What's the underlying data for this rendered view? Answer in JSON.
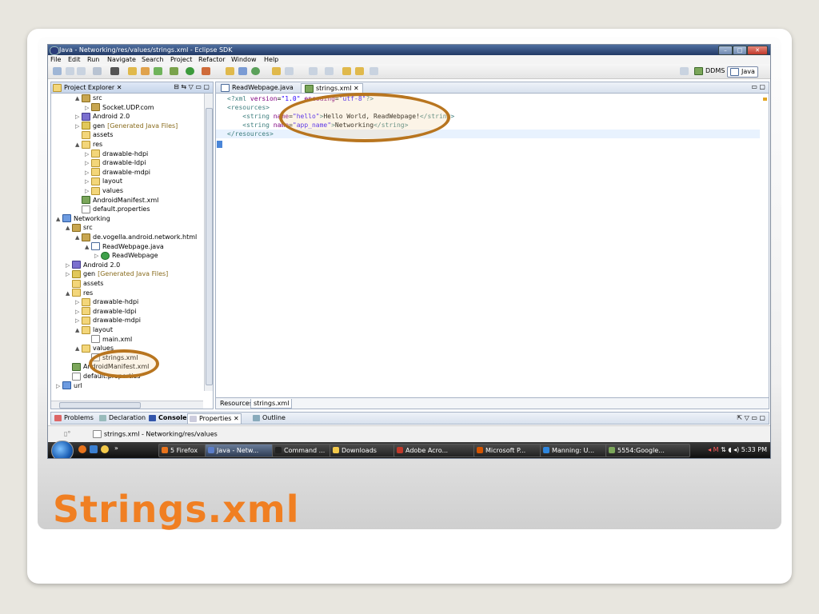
{
  "slide": {
    "title": "Strings.xml"
  },
  "window": {
    "title": "Java - Networking/res/values/strings.xml - Eclipse SDK",
    "buttons": [
      "–",
      "□",
      "✕"
    ]
  },
  "menu": [
    "File",
    "Edit",
    "Run",
    "Navigate",
    "Search",
    "Project",
    "Refactor",
    "Window",
    "Help"
  ],
  "perspectives": {
    "ddms": "DDMS",
    "java": "Java"
  },
  "project_explorer": {
    "title": "Project Explorer",
    "tree": [
      {
        "label": "src",
        "icon": "pkg",
        "twisty": "▲",
        "indent": 2
      },
      {
        "label": "Socket.UDP.com",
        "icon": "pkg",
        "twisty": "▷",
        "indent": 3
      },
      {
        "label": "Android 2.0",
        "icon": "lib",
        "twisty": "▷",
        "indent": 2
      },
      {
        "label": "gen",
        "suffix": "[Generated Java Files]",
        "icon": "gen",
        "twisty": "▷",
        "indent": 2
      },
      {
        "label": "assets",
        "icon": "fold",
        "twisty": "",
        "indent": 2
      },
      {
        "label": "res",
        "icon": "fold",
        "twisty": "▲",
        "indent": 2
      },
      {
        "label": "drawable-hdpi",
        "icon": "fold",
        "twisty": "▷",
        "indent": 3
      },
      {
        "label": "drawable-ldpi",
        "icon": "fold",
        "twisty": "▷",
        "indent": 3
      },
      {
        "label": "drawable-mdpi",
        "icon": "fold",
        "twisty": "▷",
        "indent": 3
      },
      {
        "label": "layout",
        "icon": "fold",
        "twisty": "▷",
        "indent": 3
      },
      {
        "label": "values",
        "icon": "fold",
        "twisty": "▷",
        "indent": 3
      },
      {
        "label": "AndroidManifest.xml",
        "icon": "and",
        "twisty": "",
        "indent": 2
      },
      {
        "label": "default.properties",
        "icon": "file",
        "twisty": "",
        "indent": 2
      },
      {
        "label": "Networking",
        "icon": "proj",
        "twisty": "▲",
        "indent": 0
      },
      {
        "label": "src",
        "icon": "pkg",
        "twisty": "▲",
        "indent": 1
      },
      {
        "label": "de.vogella.android.network.html",
        "icon": "pkg",
        "twisty": "▲",
        "indent": 2
      },
      {
        "label": "ReadWebpage.java",
        "icon": "java",
        "twisty": "▲",
        "indent": 3
      },
      {
        "label": "ReadWebpage",
        "icon": "cls",
        "twisty": "▷",
        "indent": 4
      },
      {
        "label": "Android 2.0",
        "icon": "lib",
        "twisty": "▷",
        "indent": 1
      },
      {
        "label": "gen",
        "suffix": "[Generated Java Files]",
        "icon": "gen",
        "twisty": "▷",
        "indent": 1
      },
      {
        "label": "assets",
        "icon": "fold",
        "twisty": "",
        "indent": 1
      },
      {
        "label": "res",
        "icon": "fold",
        "twisty": "▲",
        "indent": 1
      },
      {
        "label": "drawable-hdpi",
        "icon": "fold",
        "twisty": "▷",
        "indent": 2
      },
      {
        "label": "drawable-ldpi",
        "icon": "fold",
        "twisty": "▷",
        "indent": 2
      },
      {
        "label": "drawable-mdpi",
        "icon": "fold",
        "twisty": "▷",
        "indent": 2
      },
      {
        "label": "layout",
        "icon": "fold",
        "twisty": "▲",
        "indent": 2
      },
      {
        "label": "main.xml",
        "icon": "file",
        "twisty": "",
        "indent": 3
      },
      {
        "label": "values",
        "icon": "fold",
        "twisty": "▲",
        "indent": 2
      },
      {
        "label": "strings.xml",
        "icon": "file",
        "twisty": "",
        "indent": 3
      },
      {
        "label": "AndroidManifest.xml",
        "icon": "and",
        "twisty": "",
        "indent": 1
      },
      {
        "label": "default.properties",
        "icon": "file",
        "twisty": "",
        "indent": 1
      },
      {
        "label": "url",
        "icon": "proj",
        "twisty": "▷",
        "indent": 0
      }
    ]
  },
  "editor": {
    "tabs": [
      "ReadWebpage.java",
      "strings.xml"
    ],
    "code": [
      [
        [
          "tag",
          "<?xml "
        ],
        [
          "att",
          "version"
        ],
        [
          "txt",
          "="
        ],
        [
          "str",
          "\"1.0\""
        ],
        [
          "txt",
          " "
        ],
        [
          "att",
          "encoding"
        ],
        [
          "txt",
          "="
        ],
        [
          "str",
          "\"utf-8\""
        ],
        [
          "tag",
          "?>"
        ]
      ],
      [
        [
          "tag",
          "<resources>"
        ]
      ],
      [
        [
          "txt",
          "    "
        ],
        [
          "tag",
          "<string "
        ],
        [
          "att",
          "name"
        ],
        [
          "txt",
          "="
        ],
        [
          "str",
          "\"hello\""
        ],
        [
          "tag",
          ">"
        ],
        [
          "txt",
          "Hello World, ReadWebpage!"
        ],
        [
          "tag",
          "</string>"
        ]
      ],
      [
        [
          "txt",
          "    "
        ],
        [
          "tag",
          "<string "
        ],
        [
          "att",
          "name"
        ],
        [
          "txt",
          "="
        ],
        [
          "str",
          "\"app_name\""
        ],
        [
          "tag",
          ">"
        ],
        [
          "txt",
          "Networking"
        ],
        [
          "tag",
          "</string>"
        ]
      ],
      [
        [
          "tag",
          "</resources>"
        ]
      ]
    ],
    "bottom_tabs": [
      "Resources",
      "strings.xml"
    ]
  },
  "bottom_panel": {
    "tabs": [
      "Problems",
      "Declaration",
      "Console",
      "Properties",
      "Outline"
    ]
  },
  "status": {
    "text": "strings.xml - Networking/res/values"
  },
  "taskbar": {
    "items": [
      {
        "label": "5 Firefox",
        "color": "#e8731c"
      },
      {
        "label": "Java - Netw...",
        "color": "#5b7dc8"
      },
      {
        "label": "Command ...",
        "color": "#222"
      },
      {
        "label": "Downloads",
        "color": "#f3c94a"
      },
      {
        "label": "Adobe Acro...",
        "color": "#c0392b"
      },
      {
        "label": "Microsoft P...",
        "color": "#d35400"
      },
      {
        "label": "Manning: U...",
        "color": "#2e86de"
      },
      {
        "label": "5554:Google...",
        "color": "#7ba65a"
      }
    ],
    "clock": "5:33 PM"
  }
}
